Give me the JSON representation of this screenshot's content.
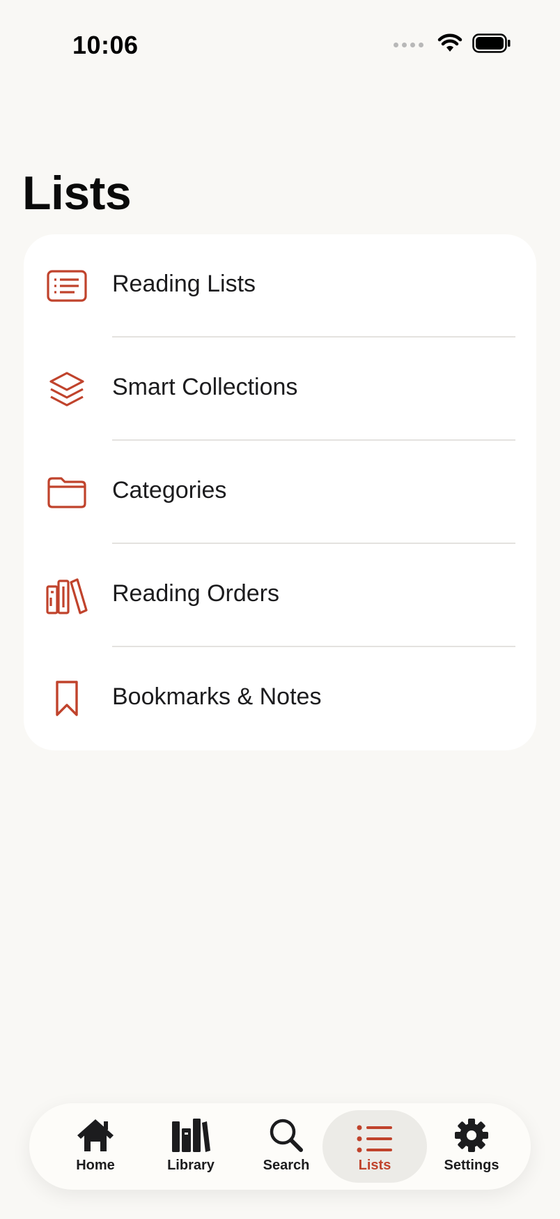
{
  "status_bar": {
    "time": "10:06",
    "icons": [
      "cellular-dots-icon",
      "wifi-icon",
      "battery-icon"
    ]
  },
  "page": {
    "title": "Lists"
  },
  "accent_color": "#c0432c",
  "list_items": [
    {
      "label": "Reading Lists",
      "icon": "list-card-icon"
    },
    {
      "label": "Smart Collections",
      "icon": "layers-stack-icon"
    },
    {
      "label": "Categories",
      "icon": "folder-icon"
    },
    {
      "label": "Reading Orders",
      "icon": "books-shelf-icon"
    },
    {
      "label": "Bookmarks & Notes",
      "icon": "bookmark-icon"
    }
  ],
  "tab_bar": {
    "items": [
      {
        "label": "Home",
        "icon": "house-icon",
        "active": false
      },
      {
        "label": "Library",
        "icon": "books-icon",
        "active": false
      },
      {
        "label": "Search",
        "icon": "magnifier-icon",
        "active": false
      },
      {
        "label": "Lists",
        "icon": "bulleted-list-icon",
        "active": true
      },
      {
        "label": "Settings",
        "icon": "gear-icon",
        "active": false
      }
    ]
  }
}
